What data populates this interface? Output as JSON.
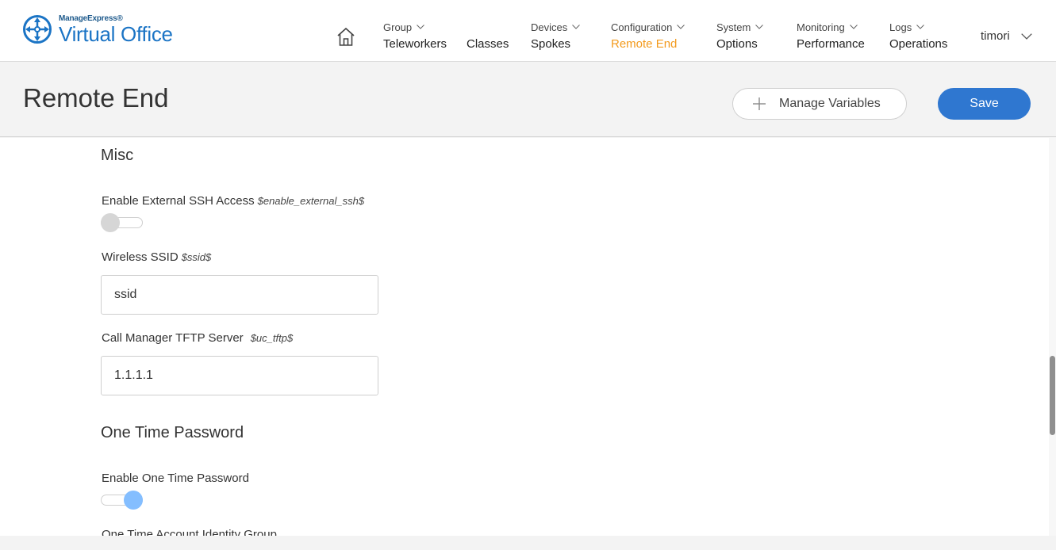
{
  "brand": {
    "small": "ManageExpress®",
    "name": "Virtual Office",
    "accent": "#1b74c5"
  },
  "nav": {
    "home_icon": "home-icon",
    "items": [
      {
        "top": "Group",
        "main": "Teleworkers"
      },
      {
        "top": "",
        "main": "Classes"
      },
      {
        "top": "Devices",
        "main": "Spokes"
      },
      {
        "top": "Configuration",
        "main": "Remote End",
        "active": true
      },
      {
        "top": "System",
        "main": "Options"
      },
      {
        "top": "Monitoring",
        "main": "Performance"
      },
      {
        "top": "Logs",
        "main": "Operations"
      }
    ],
    "active_color": "#f39a1c",
    "user": "timori"
  },
  "header": {
    "title": "Remote End",
    "manage_variables_label": "Manage Variables",
    "save_label": "Save",
    "save_color": "#2f77d0"
  },
  "sections": {
    "misc": {
      "title": "Misc",
      "ssh": {
        "label": "Enable External SSH Access",
        "var": "$enable_external_ssh$",
        "enabled": false
      },
      "ssid": {
        "label": "Wireless SSID",
        "var": "$ssid$",
        "value": "ssid"
      },
      "tftp": {
        "label": "Call Manager TFTP Server",
        "var": "$uc_tftp$",
        "value": "1.1.1.1"
      }
    },
    "otp": {
      "title": "One Time Password",
      "enable": {
        "label": "Enable One Time Password",
        "enabled": true
      },
      "identity_group": {
        "label": "One Time Account Identity Group"
      }
    }
  }
}
